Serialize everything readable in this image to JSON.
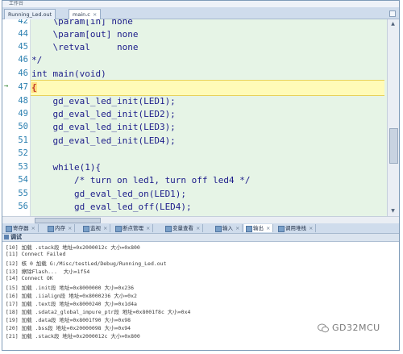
{
  "window": {
    "title": "工作台"
  },
  "tabs": [
    {
      "label": "Running_Led.out",
      "active": false
    },
    {
      "label": "main.c",
      "active": true
    }
  ],
  "editor": {
    "lines": [
      {
        "num": "42",
        "text": "    \\param[in] none"
      },
      {
        "num": "44",
        "text": "    \\param[out] none"
      },
      {
        "num": "45",
        "text": "    \\retval     none"
      },
      {
        "num": "46",
        "text": "*/"
      },
      {
        "num": "46",
        "text": "int main(void)"
      },
      {
        "num": "47",
        "text": "{"
      },
      {
        "num": "48",
        "text": "    gd_eval_led_init(LED1);"
      },
      {
        "num": "49",
        "text": "    gd_eval_led_init(LED2);"
      },
      {
        "num": "50",
        "text": "    gd_eval_led_init(LED3);"
      },
      {
        "num": "51",
        "text": "    gd_eval_led_init(LED4);"
      },
      {
        "num": "52",
        "text": ""
      },
      {
        "num": "53",
        "text": "    while(1){"
      },
      {
        "num": "54",
        "text": "        /* turn on led1, turn off led4 */"
      },
      {
        "num": "55",
        "text": "        gd_eval_led_on(LED1);"
      },
      {
        "num": "56",
        "text": "        gd_eval_led_off(LED4);"
      }
    ],
    "current_line_marker": "→"
  },
  "panel_tabs": [
    "寄存器",
    "内存",
    "监视",
    "断点管理",
    "变量查看",
    "输入",
    "输出",
    "调用堆栈"
  ],
  "output": {
    "title": "调试",
    "lines": [
      "[10] 加载 .stack段 地址=0x2000012c 大小=0x800",
      "[11] Connect Failed",
      "[12] 核 0 加载 G:/Misc/testLed/Debug/Running_Led.out",
      "[13] 擦除Flash...  大小=1f54",
      "[14] Connect OK",
      "[15] 加载 .init段 地址=0x8000000 大小=0x236",
      "[16] 加载 .iialign段 地址=0x8000236 大小=0x2",
      "[17] 加载 .text段 地址=0x8000240 大小=0x1d4a",
      "[18] 加载 .sdata2_global_impure_ptr段 地址=0x8001f8c 大小=0x4",
      "[19] 加载 .data段 地址=0x8001f90 大小=0x98",
      "[20] 加载 .bss段 地址=0x20000098 大小=0x94",
      "[21] 加载 .stack段 地址=0x2000012c 大小=0x800"
    ]
  },
  "watermark": {
    "text": "GD32MCU"
  },
  "colors": {
    "editor_bg": "#e6f4e6",
    "current_line": "#fffbb8",
    "keyword": "#0000c8",
    "comment": "#0a7a0a",
    "line_number": "#2a7fb0"
  }
}
